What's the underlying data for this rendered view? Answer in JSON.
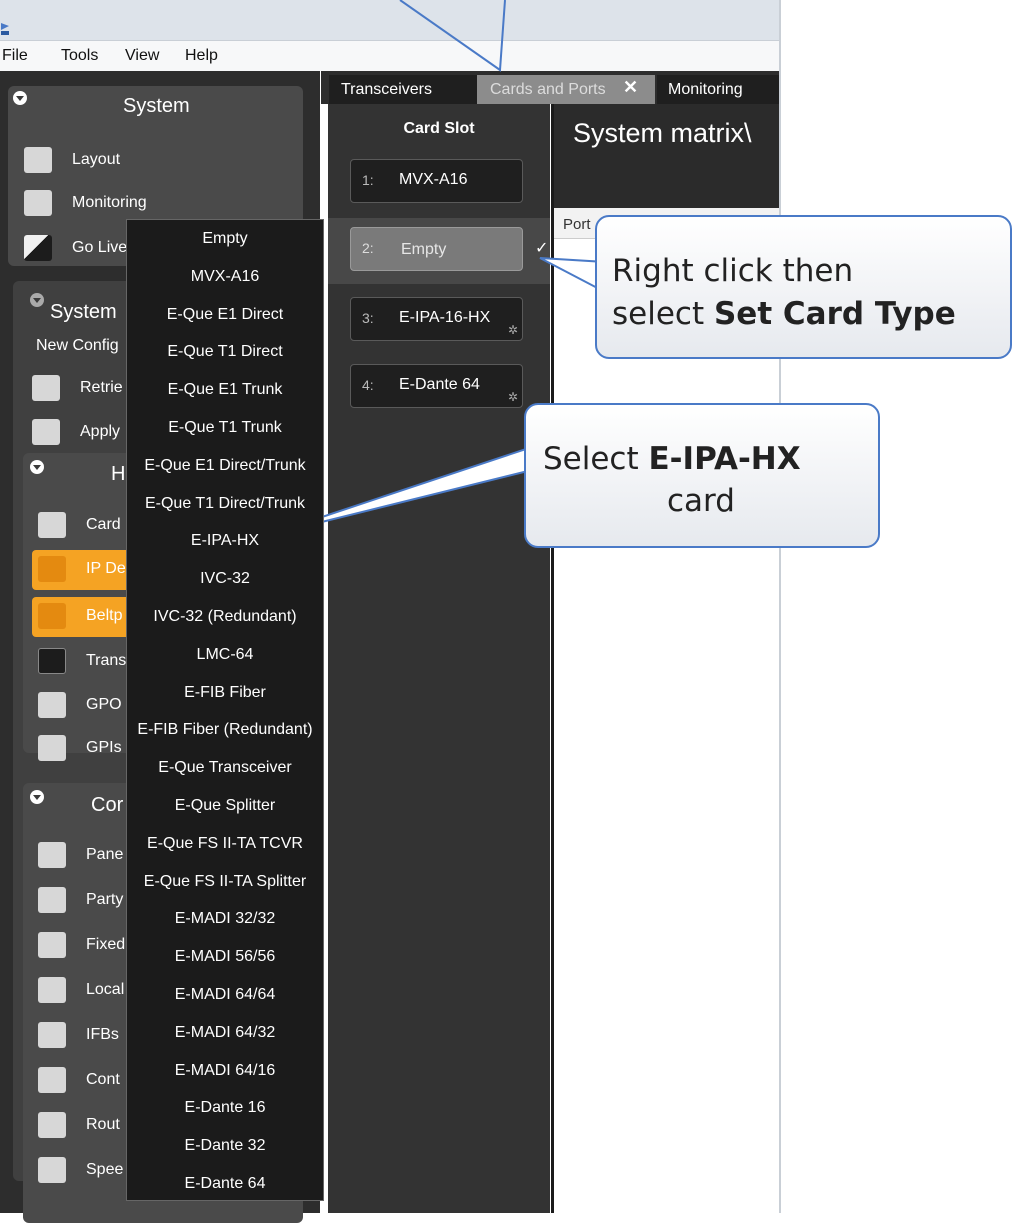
{
  "menubar": {
    "items": [
      "File",
      "Tools",
      "View",
      "Help"
    ]
  },
  "system_panel": {
    "title": "System",
    "items": [
      {
        "label": "Layout",
        "icon": "layout-icon"
      },
      {
        "label": "Monitoring",
        "icon": "monitoring-icon"
      },
      {
        "label": "Go Live",
        "icon": "go-live-icon"
      }
    ]
  },
  "config_panel": {
    "title": "System",
    "subtitle": "New Config",
    "items": [
      {
        "label": "Retrie",
        "icon": "retrieve-icon"
      },
      {
        "label": "Apply",
        "icon": "apply-icon"
      }
    ]
  },
  "hardware_panel": {
    "title": "H",
    "items": [
      {
        "label": "Card",
        "icon": "cards-icon"
      },
      {
        "label": "IP De",
        "icon": "ip-devices-icon"
      },
      {
        "label": "Beltp",
        "icon": "beltpack-icon"
      },
      {
        "label": "Trans",
        "icon": "transceiver-icon"
      },
      {
        "label": "GPO",
        "icon": "gpo-icon"
      },
      {
        "label": "GPIs",
        "icon": "gpi-icon"
      }
    ]
  },
  "conf_panel": {
    "title": "Cor",
    "items": [
      {
        "label": "Pane",
        "icon": "panel-icon"
      },
      {
        "label": "Party",
        "icon": "party-line-icon"
      },
      {
        "label": "Fixed",
        "icon": "fixed-group-icon"
      },
      {
        "label": "Local",
        "icon": "local-icon"
      },
      {
        "label": "IFBs",
        "icon": "ifb-icon"
      },
      {
        "label": "Cont",
        "icon": "control-icon"
      },
      {
        "label": "Rout",
        "icon": "route-icon"
      },
      {
        "label": "Spee",
        "icon": "speed-dial-icon"
      }
    ]
  },
  "tabs": [
    {
      "label": "Transceivers"
    },
    {
      "label": "Cards and Ports"
    },
    {
      "label": "Monitoring"
    }
  ],
  "card_slot": {
    "title": "Card Slot",
    "slots": [
      {
        "num": "1:",
        "name": "MVX-A16"
      },
      {
        "num": "2:",
        "name": "Empty"
      },
      {
        "num": "3:",
        "name": "E-IPA-16-HX"
      },
      {
        "num": "4:",
        "name": "E-Dante 64"
      }
    ]
  },
  "right_panel": {
    "title": "System matrix\\",
    "column": "Port"
  },
  "context_menu": {
    "items": [
      "Empty",
      "MVX-A16",
      "E-Que E1 Direct",
      "E-Que T1 Direct",
      "E-Que E1 Trunk",
      "E-Que T1 Trunk",
      "E-Que E1 Direct/Trunk",
      "E-Que T1 Direct/Trunk",
      "E-IPA-HX",
      "IVC-32",
      "IVC-32 (Redundant)",
      "LMC-64",
      "E-FIB Fiber",
      "E-FIB Fiber (Redundant)",
      "E-Que Transceiver",
      "E-Que Splitter",
      "E-Que FS II-TA TCVR",
      "E-Que FS II-TA Splitter",
      "E-MADI 32/32",
      "E-MADI 56/56",
      "E-MADI 64/64",
      "E-MADI 64/32",
      "E-MADI 64/16",
      "E-Dante 16",
      "E-Dante 32",
      "E-Dante 64"
    ]
  },
  "callouts": {
    "right_click": {
      "line1": "Right click then",
      "line2_prefix": "select ",
      "line2_bold": "Set Card Type"
    },
    "select_card": {
      "line1_prefix": "Select ",
      "line1_bold": "E-IPA-HX",
      "line2": "card"
    }
  },
  "colors": {
    "accent_orange": "#f5a323",
    "callout_border": "#4a7ac7",
    "app_dark": "#2d2d2d"
  }
}
